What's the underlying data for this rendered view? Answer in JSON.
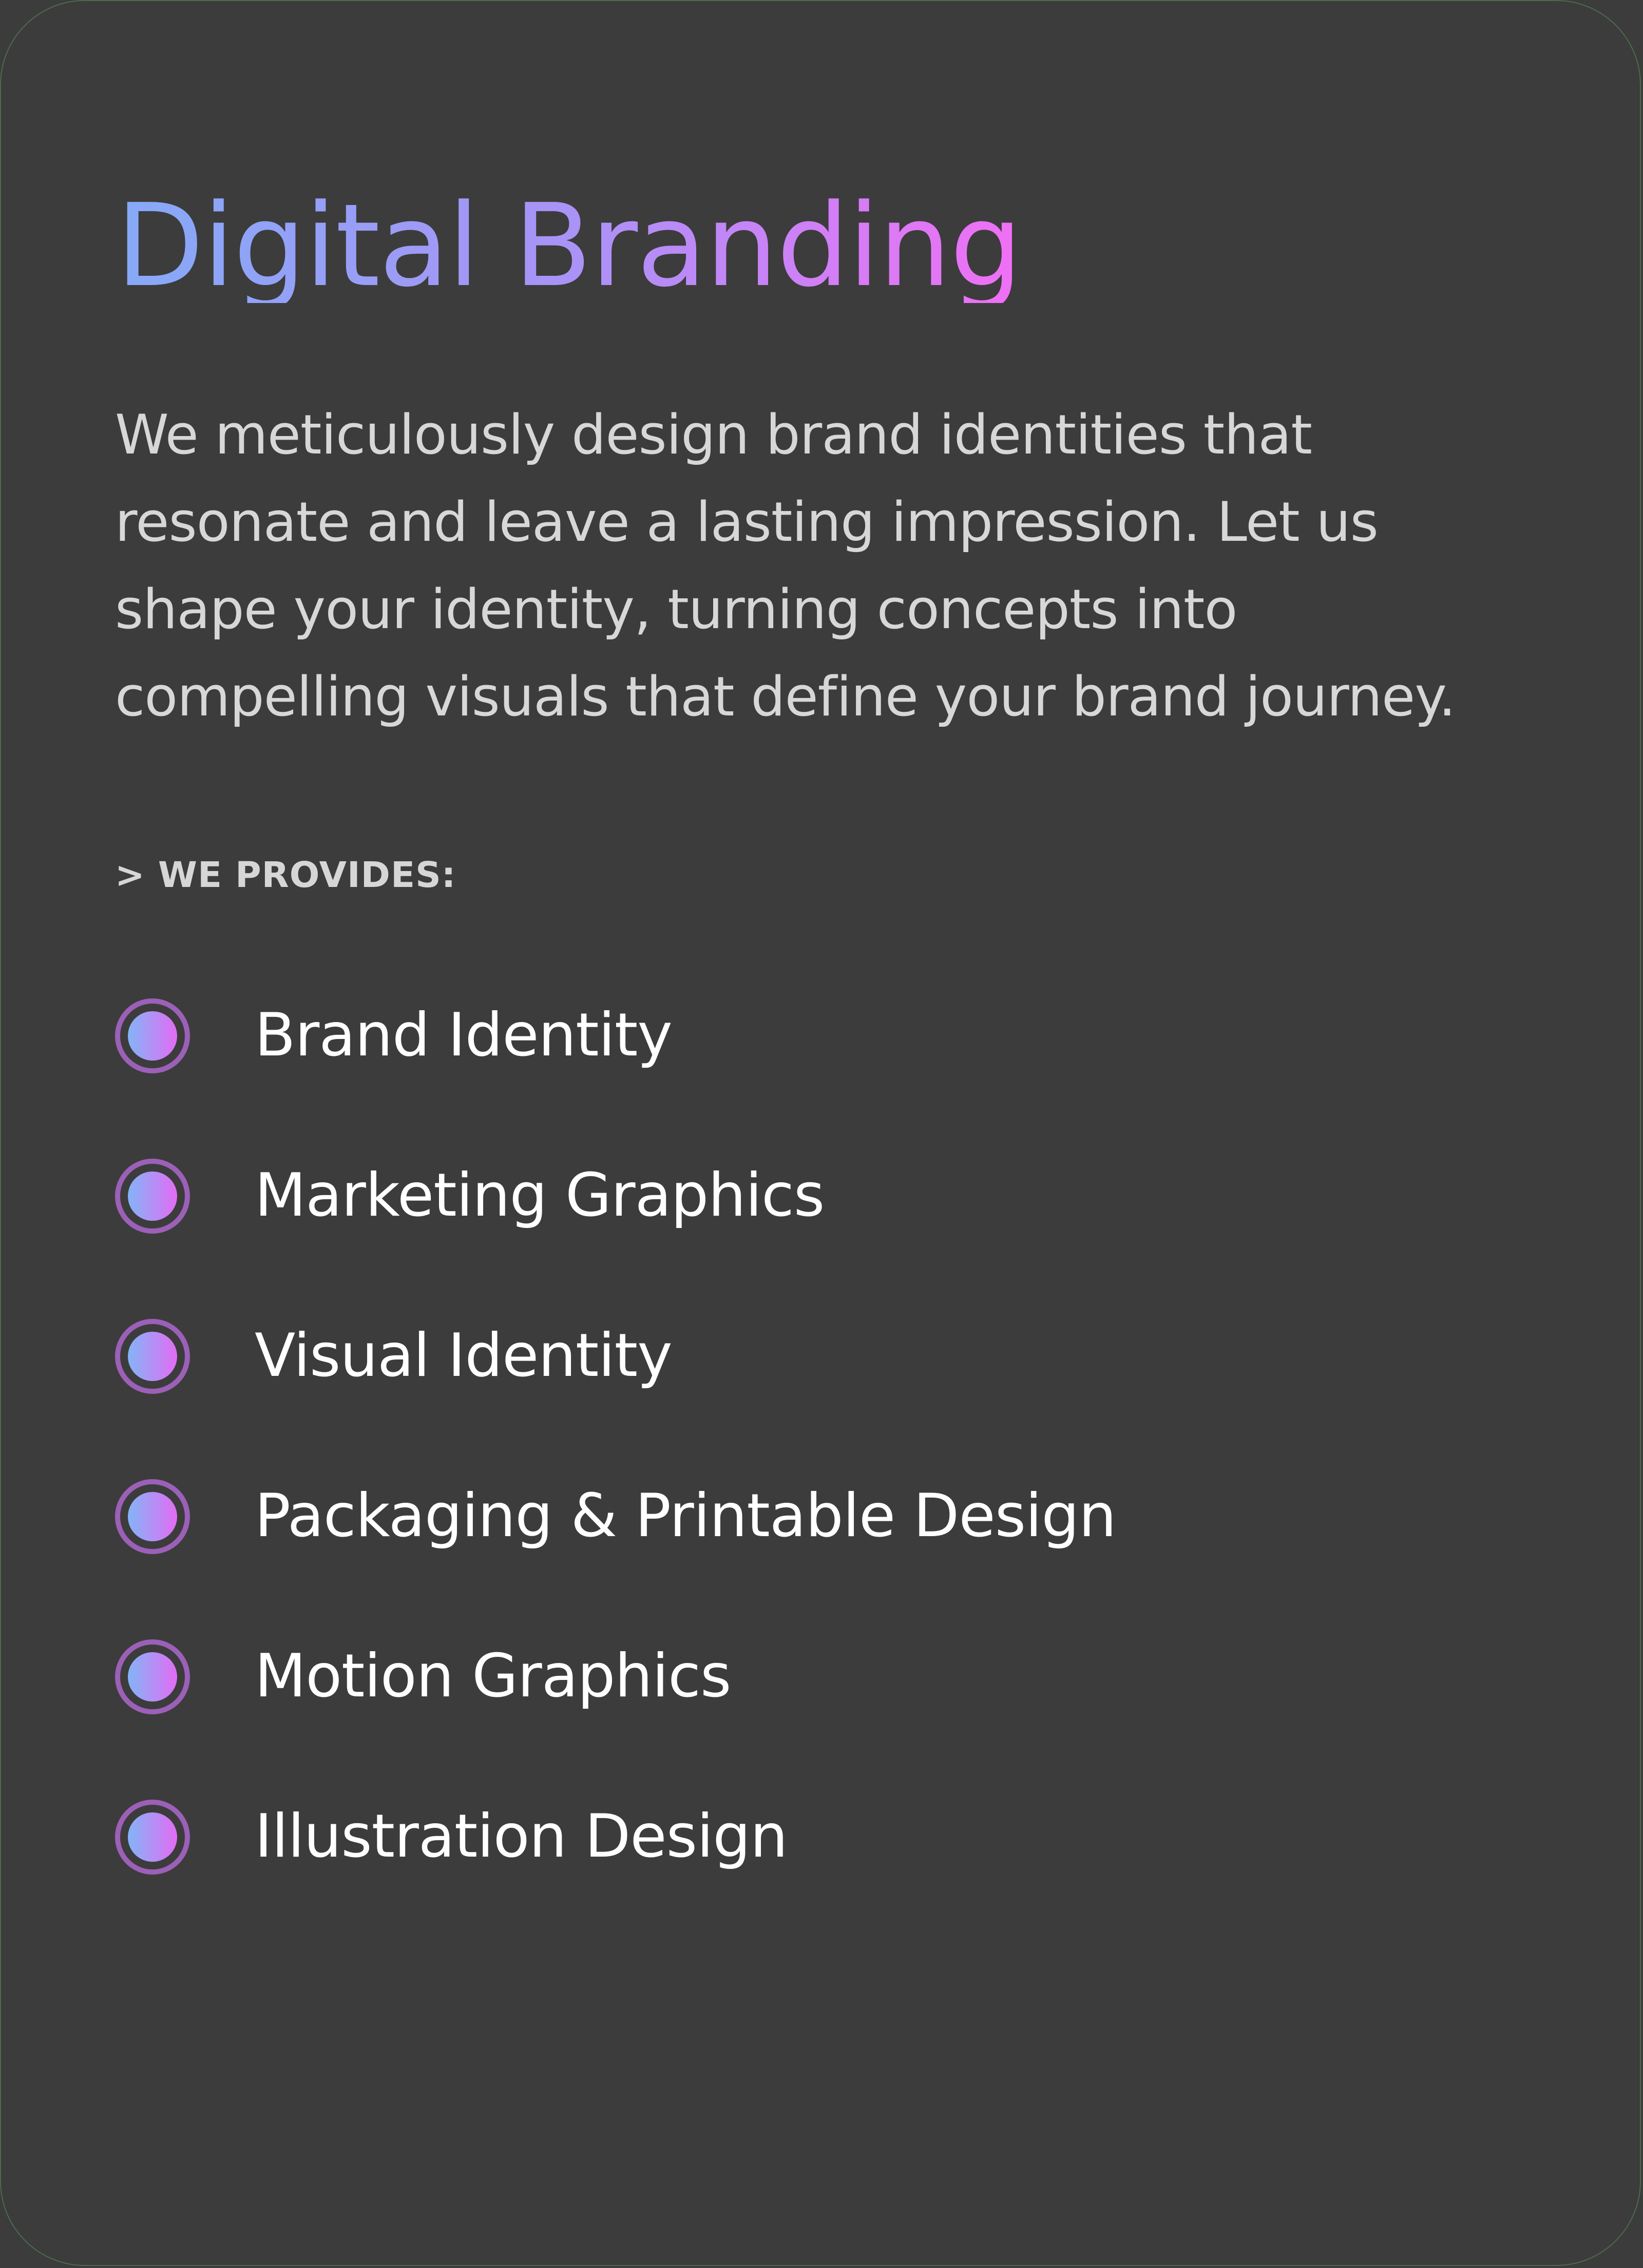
{
  "page": {
    "background": "#3c3c3c",
    "border_color": "#4d6a4f"
  },
  "header": {
    "title": "Digital Branding",
    "gradient": [
      "#86aaf7",
      "#a993f6",
      "#f06ff5"
    ]
  },
  "description": {
    "text": "We meticulously design brand identities that resonate and leave a lasting impression. Let us shape your identity, turning concepts into compelling visuals that define your brand journey."
  },
  "services_section": {
    "label": "> WE PROVIDES:",
    "items": [
      {
        "label": "Brand Identity",
        "icon": "radio-bullet-icon"
      },
      {
        "label": "Marketing Graphics",
        "icon": "radio-bullet-icon"
      },
      {
        "label": "Visual Identity",
        "icon": "radio-bullet-icon"
      },
      {
        "label": "Packaging & Printable Design",
        "icon": "radio-bullet-icon"
      },
      {
        "label": "Motion Graphics",
        "icon": "radio-bullet-icon"
      },
      {
        "label": "Illustration Design",
        "icon": "radio-bullet-icon"
      }
    ]
  },
  "colors": {
    "text_primary": "#ffffff",
    "text_secondary": "#d7d7d7",
    "bullet_ring": "#9c60b8",
    "bullet_gradient": [
      "#84b4f7",
      "#e26cf4"
    ]
  }
}
